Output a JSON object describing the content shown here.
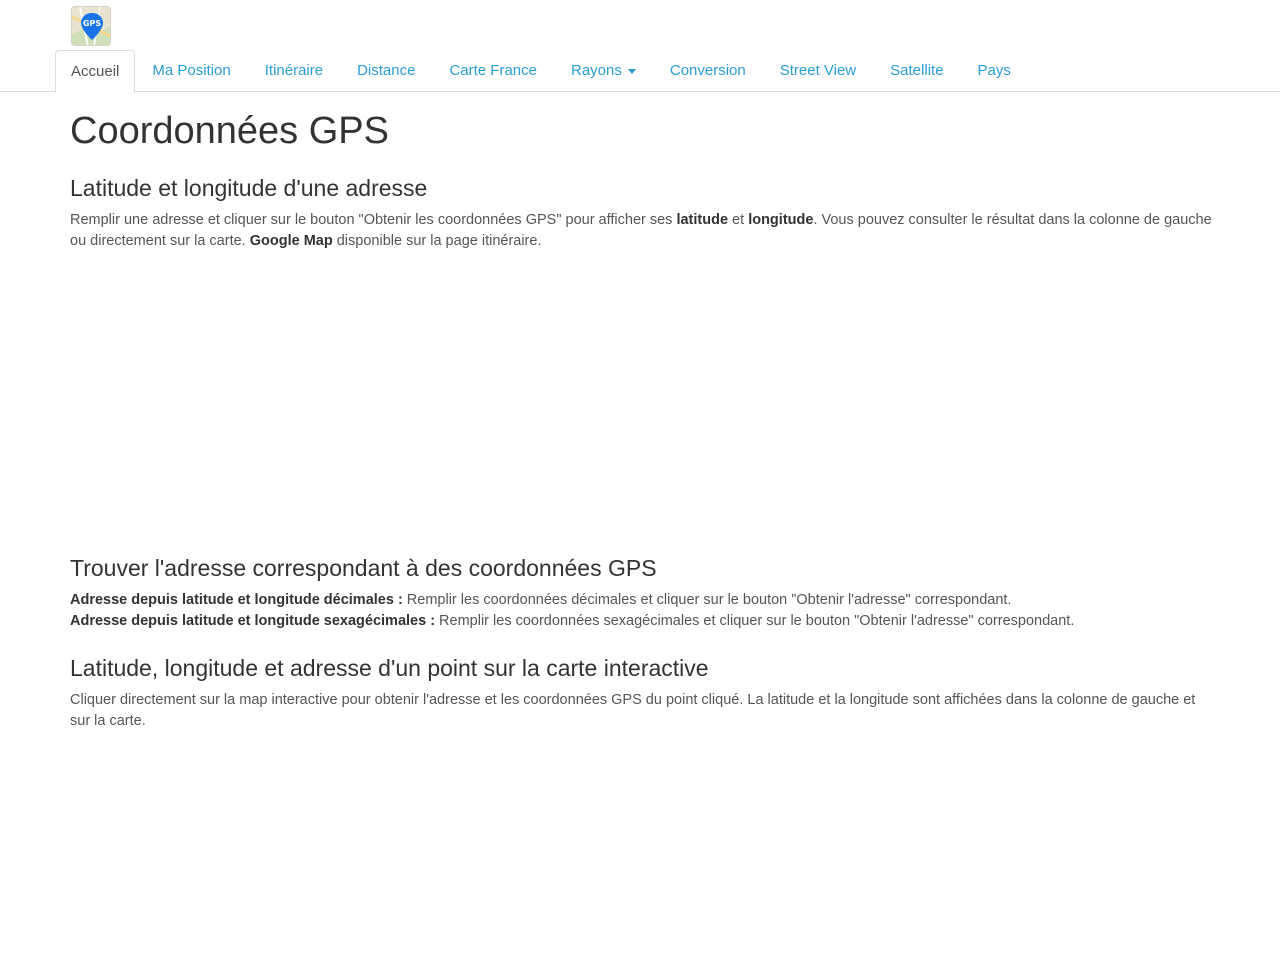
{
  "logo": {
    "icon": "gps-map-pin-icon",
    "text": "GPS"
  },
  "nav": {
    "items": [
      {
        "label": "Accueil",
        "active": true
      },
      {
        "label": "Ma Position"
      },
      {
        "label": "Itinéraire"
      },
      {
        "label": "Distance"
      },
      {
        "label": "Carte France"
      },
      {
        "label": "Rayons",
        "dropdown": true
      },
      {
        "label": "Conversion"
      },
      {
        "label": "Street View"
      },
      {
        "label": "Satellite"
      },
      {
        "label": "Pays"
      }
    ]
  },
  "page": {
    "title": "Coordonnées GPS",
    "section1": {
      "heading": "Latitude et longitude d'une adresse",
      "text_part1": "Remplir une adresse et cliquer sur le bouton \"Obtenir les coordonnées GPS\" pour afficher ses ",
      "bold1": "latitude",
      "text_part2": " et ",
      "bold2": "longitude",
      "text_part3": ". Vous pouvez consulter le résultat dans la colonne de gauche ou directement sur la carte. ",
      "bold3": "Google Map",
      "text_part4": " disponible sur la page itinéraire."
    },
    "section2": {
      "heading": "Trouver l'adresse correspondant à des coordonnées GPS",
      "line1_bold": "Adresse depuis latitude et longitude décimales :",
      "line1_text": " Remplir les coordonnées décimales et cliquer sur le bouton \"Obtenir l'adresse\" correspondant.",
      "line2_bold": "Adresse depuis latitude et longitude sexagécimales :",
      "line2_text": " Remplir les coordonnées sexagécimales et cliquer sur le bouton \"Obtenir l'adresse\" correspondant."
    },
    "section3": {
      "heading": "Latitude, longitude et adresse d'un point sur la carte interactive",
      "text": "Cliquer directement sur la map interactive pour obtenir l'adresse et les coordonnées GPS du point cliqué. La latitude et la longitude sont affichées dans la colonne de gauche et sur la carte."
    }
  },
  "colors": {
    "link": "#2a9fd6",
    "text": "#555555",
    "heading": "#333333",
    "pin": "#1a73e8"
  }
}
